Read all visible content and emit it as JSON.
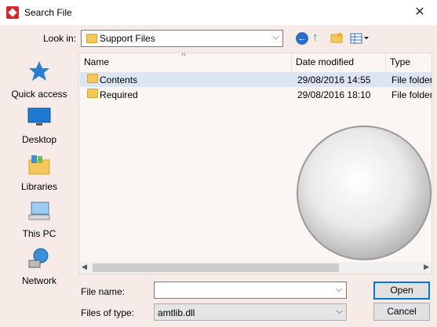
{
  "window": {
    "title": "Search File",
    "close_glyph": "✕"
  },
  "toolbar": {
    "lookin_label": "Look in:",
    "lookin_value": "Support Files",
    "icons": [
      "back-icon",
      "up-folder-icon",
      "new-folder-icon",
      "view-menu-icon"
    ]
  },
  "places": [
    {
      "label": "Quick access",
      "icon": "star-icon"
    },
    {
      "label": "Desktop",
      "icon": "desktop-icon"
    },
    {
      "label": "Libraries",
      "icon": "libraries-icon"
    },
    {
      "label": "This PC",
      "icon": "computer-icon"
    },
    {
      "label": "Network",
      "icon": "network-icon"
    }
  ],
  "filelist": {
    "columns": [
      "Name",
      "Date modified",
      "Type"
    ],
    "rows": [
      {
        "name": "Contents",
        "date": "29/08/2016 14:55",
        "type": "File folder",
        "selected": true
      },
      {
        "name": "Required",
        "date": "29/08/2016 18:10",
        "type": "File folder",
        "selected": false
      }
    ]
  },
  "form": {
    "filename_label": "File name:",
    "filename_value": "",
    "filetype_label": "Files of type:",
    "filetype_value": "amtlib.dll"
  },
  "buttons": {
    "open": "Open",
    "cancel": "Cancel"
  },
  "colors": {
    "accent": "#0078d7",
    "selection": "#dbe6f2",
    "background": "#f6ebe6"
  }
}
